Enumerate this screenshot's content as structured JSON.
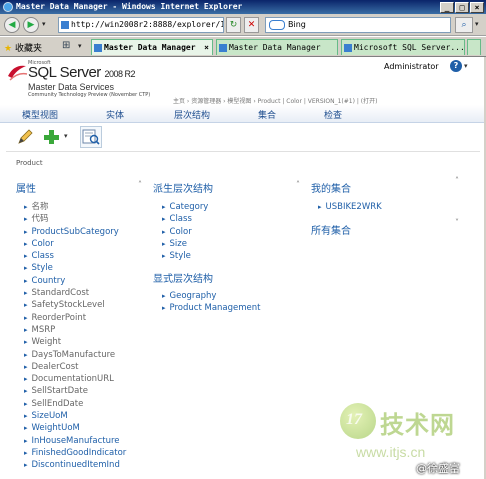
{
  "window": {
    "title": "Master Data Manager - Windows Internet Explorer",
    "buttons": {
      "minimize": "_",
      "maximize": "□",
      "close": "×"
    }
  },
  "address_bar": {
    "url": "http://win2008r2:8888/explorer/1",
    "search_placeholder": "Bing"
  },
  "favorites": {
    "label": "收藏夹"
  },
  "tabs": [
    {
      "label": "Master Data Manager",
      "active": true
    },
    {
      "label": "Master Data Manager",
      "active": false
    },
    {
      "label": "Microsoft SQL Server...",
      "active": false
    }
  ],
  "header": {
    "logo_small": "Microsoft",
    "product": "SQL Server",
    "version": "2008 R2",
    "app_name": "Master Data Services",
    "preview": "Community Technology Preview (November CTP)",
    "breadcrumb": "主页  ›  资源管理器  ›  模型视图  ›  Product  |  Color  |  VERSION_1(#1)  |  (打开)",
    "user": "Administrator",
    "help": "?",
    "help_dropdown": "▾"
  },
  "menu": [
    {
      "label": "模型视图"
    },
    {
      "label": "实体"
    },
    {
      "label": "层次结构"
    },
    {
      "label": "集合"
    },
    {
      "label": "检查"
    }
  ],
  "toolbar": {
    "icons": [
      "edit-pencil-icon",
      "add-plus-icon",
      "dropdown-icon",
      "search-view-icon"
    ]
  },
  "page_label": "Product",
  "attributes": {
    "title": "属性",
    "caret": "˄",
    "items": [
      {
        "label": "名称",
        "link": false
      },
      {
        "label": "代码",
        "link": false
      },
      {
        "label": "ProductSubCategory",
        "link": true
      },
      {
        "label": "Color",
        "link": true
      },
      {
        "label": "Class",
        "link": true
      },
      {
        "label": "Style",
        "link": true
      },
      {
        "label": "Country",
        "link": true
      },
      {
        "label": "StandardCost",
        "link": false
      },
      {
        "label": "SafetyStockLevel",
        "link": false
      },
      {
        "label": "ReorderPoint",
        "link": false
      },
      {
        "label": "MSRP",
        "link": false
      },
      {
        "label": "Weight",
        "link": false
      },
      {
        "label": "DaysToManufacture",
        "link": false
      },
      {
        "label": "DealerCost",
        "link": false
      },
      {
        "label": "DocumentationURL",
        "link": false
      },
      {
        "label": "SellStartDate",
        "link": false
      },
      {
        "label": "SellEndDate",
        "link": false
      },
      {
        "label": "SizeUoM",
        "link": true
      },
      {
        "label": "WeightUoM",
        "link": true
      },
      {
        "label": "InHouseManufacture",
        "link": true
      },
      {
        "label": "FinishedGoodIndicator",
        "link": true
      },
      {
        "label": "DiscontinuedItemInd",
        "link": true
      }
    ]
  },
  "derived_hierarchies": {
    "title": "派生层次结构",
    "caret": "˄",
    "items": [
      "Category",
      "Class",
      "Color",
      "Size",
      "Style"
    ]
  },
  "explicit_hierarchies": {
    "title": "显式层次结构",
    "items": [
      "Geography",
      "Product Management"
    ]
  },
  "my_collections": {
    "title": "我的集合",
    "caret": "˄",
    "items": [
      "USBIKE2WRK"
    ]
  },
  "all_collections": {
    "title": "所有集合",
    "caret": "˅"
  },
  "watermark": {
    "mark": "17",
    "site_name": "技术网",
    "url": "www.itjs.cn",
    "author": "@徐盛富"
  }
}
